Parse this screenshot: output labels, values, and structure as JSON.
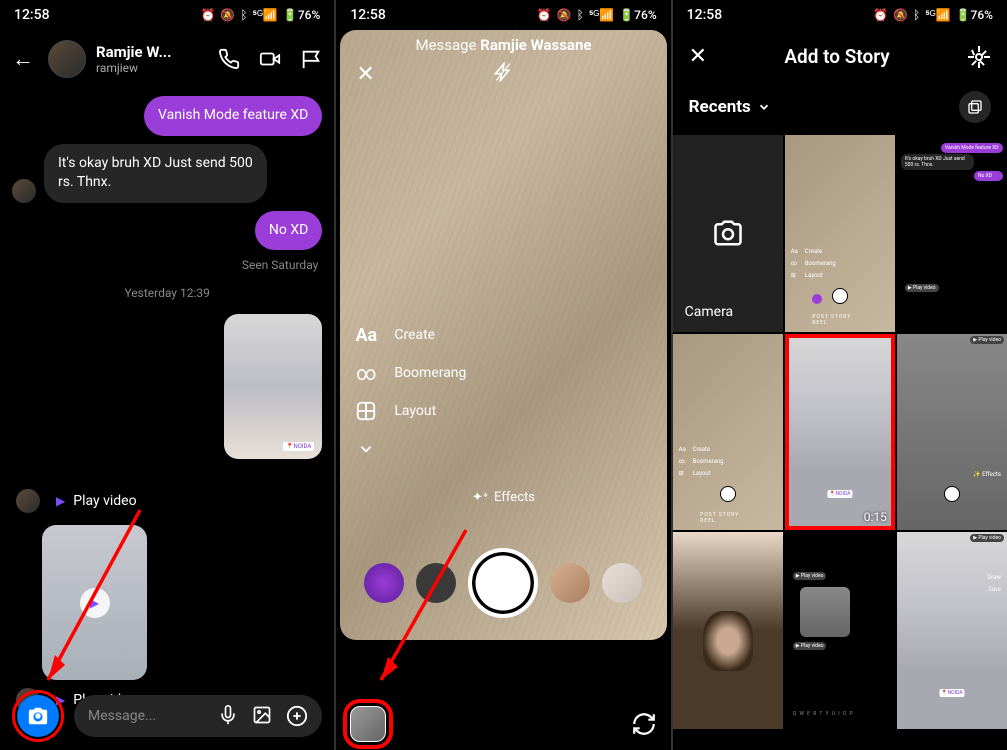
{
  "status": {
    "time": "12:58",
    "battery": "76%"
  },
  "screen1": {
    "contactName": "Ramjie W...",
    "username": "ramjiew",
    "messages": {
      "vanish": "Vanish Mode feature XD",
      "reply1": "It's okay bruh XD Just send 500 rs. Thnx.",
      "reply2": "No XD",
      "seen": "Seen Saturday",
      "timestamp": "Yesterday 12:39",
      "playVideo": "Play video",
      "noidaBadge": "📍NOIDA"
    },
    "input": {
      "placeholder": "Message..."
    }
  },
  "screen2": {
    "header": {
      "prefix": "Message ",
      "name": "Ramjie Wassane"
    },
    "options": {
      "create": "Create",
      "boomerang": "Boomerang",
      "layout": "Layout"
    },
    "effects": "Effects"
  },
  "screen3": {
    "title": "Add to Story",
    "recents": "Recents",
    "camera": "Camera",
    "duration": "0:15",
    "miniChat": {
      "vanish": "Vanish Mode feature XD",
      "msg": "It's okay bruh XD Just send 500 rs. Thnx.",
      "no": "No XD"
    },
    "miniPlay": "▶ Play video",
    "miniNoida": "📍NOIDA",
    "miniKb": "Q W E R T Y U I O P",
    "miniModes": "POST   STORY   REEL",
    "miniOpts": {
      "aa": "Aa",
      "create": "Create",
      "boomerang": "Boomerang",
      "layout": "Layout",
      "effects": "✨ Effects",
      "draw": "Draw",
      "save": "Save"
    }
  }
}
